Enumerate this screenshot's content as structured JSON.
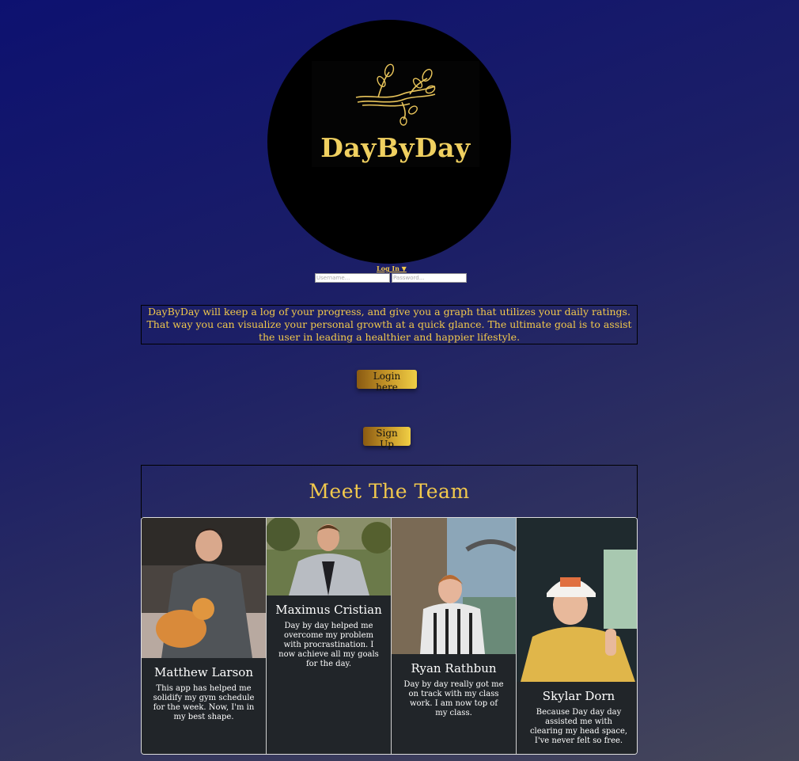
{
  "logo": {
    "title": "DayByDay",
    "icon": "tree-branch-icon",
    "accent_color": "#f0d060"
  },
  "login": {
    "toggle_label": "Log In ▼",
    "username_placeholder": "Username...",
    "password_placeholder": "Password..."
  },
  "description": "DayByDay will keep a log of your progress, and give you a graph that utilizes your daily ratings. That way you can visualize your personal growth at a quick glance. The ultimate goal is to assist the user in leading a healthier and happier lifestyle.",
  "buttons": {
    "login_here": "Login here",
    "sign_up": "Sign Up"
  },
  "team": {
    "heading": "Meet The Team",
    "members": [
      {
        "name": "Matthew Larson",
        "quote": "This app has helped me solidify my gym schedule for the week. Now, I'm in my best shape."
      },
      {
        "name": "Maximus Cristian",
        "quote": "Day by day helped me overcome my problem with procrastination. I now achieve all my goals for the day."
      },
      {
        "name": "Ryan Rathbun",
        "quote": "Day by day really got me on track with my class work. I am now top of my class."
      },
      {
        "name": "Skylar Dorn",
        "quote": "Because Day day day assisted me with clearing my head space, I've never felt so free."
      }
    ]
  },
  "colors": {
    "gold": "#f2c94c",
    "card_bg": "#212529"
  }
}
